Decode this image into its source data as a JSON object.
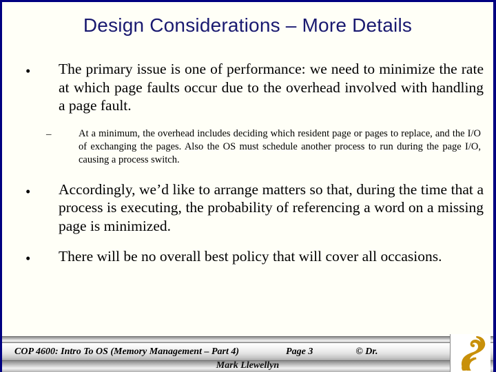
{
  "slide": {
    "title": "Design Considerations – More Details",
    "title_color": "#191970",
    "border_color": "#000080",
    "background_color": "#fffff7"
  },
  "content": {
    "bullets": [
      {
        "level": 1,
        "marker": "•",
        "text": "The primary issue is one of performance: we need to minimize the rate at which page faults occur due to the overhead involved with handling a page fault."
      },
      {
        "level": 2,
        "marker": "–",
        "text": "At a minimum, the overhead includes deciding which resident page or pages to replace, and the I/O of exchanging the pages.  Also the OS must schedule another process to run during the page I/O, causing a process switch."
      },
      {
        "level": 1,
        "marker": "•",
        "text": "Accordingly, we’d like to arrange matters so that, during the time that a process is executing, the probability of referencing a word on a missing page is minimized."
      },
      {
        "level": 1,
        "marker": "•",
        "text": "There will be no overall best policy that will cover all occasions."
      }
    ]
  },
  "footer": {
    "course": "COP 4600: Intro To OS  (Memory Management – Part 4)",
    "page": "Page 3",
    "copyright": "© Dr.",
    "author": "Mark Llewellyn",
    "logo_name": "ucf-pegasus-logo",
    "logo_color": "#C8900A"
  }
}
